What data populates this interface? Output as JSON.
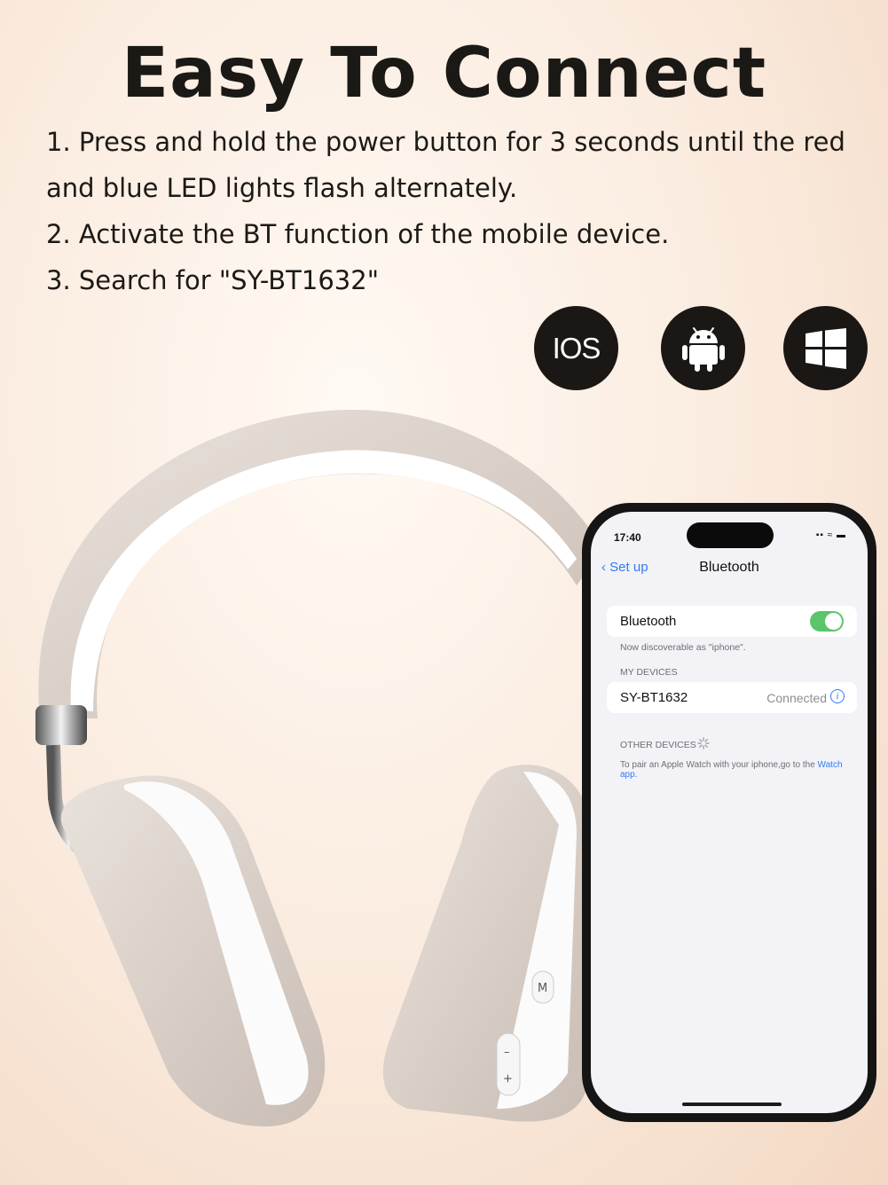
{
  "title": "Easy To Connect",
  "steps": [
    "1. Press and hold the power button for 3 seconds until the red and blue LED lights flash alternately.",
    "2. Activate the BT function of the mobile device.",
    "3. Search for \"SY-BT1632\""
  ],
  "os_badges": {
    "ios": "IOS",
    "android_icon": "android-icon",
    "windows_icon": "windows-icon"
  },
  "headphones": {
    "buttons": [
      "M",
      "–",
      "+"
    ]
  },
  "phone": {
    "time": "17:40",
    "back_label": "Set up",
    "nav_title": "Bluetooth",
    "bluetooth_label": "Bluetooth",
    "bluetooth_on": true,
    "discoverable": "Now discoverable as \"iphone\".",
    "my_devices_header": "MY DEVICES",
    "device_name": "SY-BT1632",
    "device_status": "Connected",
    "other_devices_header": "OTHER DEVICES",
    "pair_text": "To pair an Apple Watch with your iphone,go to the ",
    "pair_link": "Watch app."
  },
  "colors": {
    "accent": "#2f7cf6",
    "toggle_on": "#5cc46a",
    "badge": "#1a1714"
  }
}
